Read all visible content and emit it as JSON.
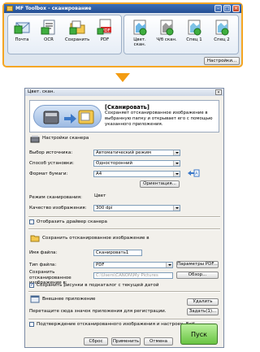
{
  "toolbox": {
    "title": "MF Toolbox - сканирование",
    "left_tools": [
      {
        "label": "Почта",
        "icon": "mail-icon"
      },
      {
        "label": "OCR",
        "icon": "ocr-icon"
      },
      {
        "label": "Сохранить",
        "icon": "folder-icon"
      },
      {
        "label": "PDF",
        "icon": "pdf-icon"
      }
    ],
    "right_tools": [
      {
        "label": "Цвет. скан.",
        "icon": "color-scan-icon"
      },
      {
        "label": "Ч/б скан.",
        "icon": "bw-scan-icon"
      },
      {
        "label": "Спец 1",
        "icon": "custom1-icon"
      },
      {
        "label": "Спец 2",
        "icon": "custom2-icon"
      }
    ],
    "settings_button": "Настройки..."
  },
  "dialog": {
    "title": "Цвет. скан.",
    "header_title": "[Сканировать]",
    "header_desc": "Сохраняет отсканированное изображение в выбранную папку и открывает его с помощью указанного приложения.",
    "scanner_section": "Настройки сканера",
    "source_label": "Выбор источника:",
    "source_value": "Автоматический режим",
    "method_label": "Способ установки:",
    "method_value": "Односторонний",
    "paper_label": "Формат бумаги:",
    "paper_value": "A4",
    "orientation_button": "Ориентация...",
    "scan_mode_label": "Режим сканирования:",
    "scan_mode_value": "Цвет",
    "quality_label": "Качество изображения:",
    "quality_value": "300 dpi",
    "show_driver_label": "Отобразить драйвер сканера",
    "save_section": "Сохранить отсканированное изображение в",
    "filename_label": "Имя файла:",
    "filename_value": "Сканировать1",
    "filetype_label": "Тип файла:",
    "filetype_value": "PDF",
    "pdf_params_button": "Параметры PDF...",
    "save_to_label": "Сохранить отсканированное изображение в:",
    "save_to_value": "C:\\Users\\CANON\\My Pictures",
    "browse_button": "Обзор...",
    "subfolder_label": "Сохранить рисунки в подкаталог с текущей датой",
    "app_section": "Внешнее приложение",
    "delete_button": "Удалить",
    "drag_hint": "Перетащите сюда значок приложения для регистрации.",
    "set_button": "Задать(1)...",
    "confirm_label": "Подтверждение отсканированного изображения и настроек. Exif",
    "reset_button": "Сброс",
    "apply_button": "Применить",
    "cancel_button": "Отмена",
    "start_button": "Пуск"
  },
  "colors": {
    "toolbox_highlight": "#f5a623",
    "arrow": "#f39c12",
    "start_button": "#69c443",
    "title_bar": "#2f5ca3"
  }
}
